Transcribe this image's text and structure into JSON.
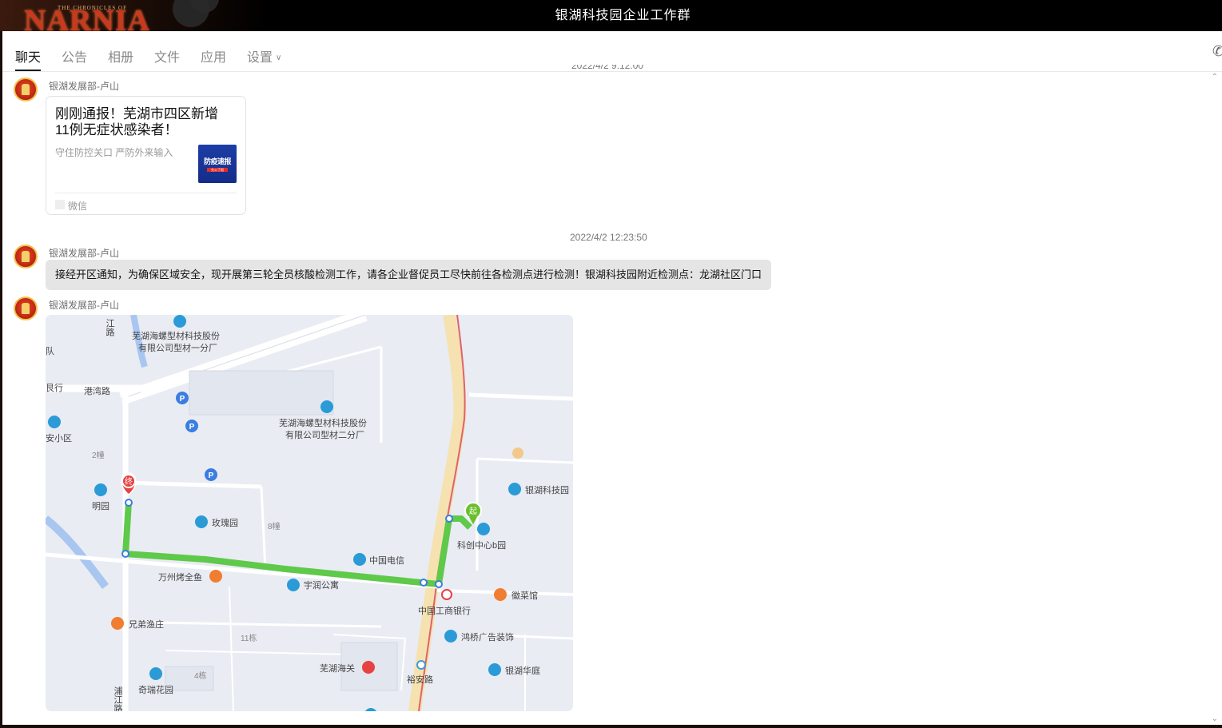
{
  "window": {
    "title": "银湖科技园企业工作群",
    "logo_top": "THE CHRONICLES OF",
    "logo_main": "NARNIA"
  },
  "tabs": [
    {
      "label": "聊天",
      "active": true
    },
    {
      "label": "公告"
    },
    {
      "label": "相册"
    },
    {
      "label": "文件"
    },
    {
      "label": "应用"
    },
    {
      "label": "设置"
    }
  ],
  "messages": [
    {
      "sender": "银湖发展部-卢山",
      "type": "article-card",
      "title": "刚刚通报！芜湖市四区新增11例无症状感染者！",
      "desc": "守住防控关口  严防外来输入",
      "thumb_text": "防疫速报",
      "thumb_sub": "先公了报",
      "source": "微信"
    },
    {
      "timestamp": "2022/4/2 12:23:50",
      "sender": "银湖发展部-卢山",
      "type": "text",
      "text": "接经开区通知，为确保区域安全，现开展第三轮全员核酸检测工作，请各企业督促员工尽快前往各检测点进行检测！银湖科技园附近检测点：龙湖社区门口"
    },
    {
      "sender": "银湖发展部-卢山",
      "type": "map-image",
      "labels": {
        "company1_l1": "芜湖海螺型材科技股份",
        "company1_l2": "有限公司型材一分厂",
        "company2_l1": "芜湖海螺型材科技股份",
        "company2_l2": "有限公司型材二分厂",
        "gangwan": "港湾路",
        "dui": "队",
        "yinhang": "艮行",
        "anxiaoqu": "安小区",
        "b2": "2幢",
        "mingyuan": "明园",
        "meiguiyuan": "玫瑰园",
        "b8": "8幢",
        "chinatelecom": "中国电信",
        "wanzhou": "万州烤全鱼",
        "yurun": "宇润公寓",
        "icbc": "中国工商银行",
        "xiongdi": "兄弟渔庄",
        "b11": "11栋",
        "customs": "芜湖海关",
        "b4": "4栋",
        "qirui": "奇瑞花园",
        "yuanroad": "裕安路",
        "yinhupark": "银湖科技园",
        "kechuang": "科创中心b园",
        "huicai": "徽菜馆",
        "hongqiao": "鸿桥广告装饰",
        "yinhuhuating": "银湖华庭",
        "pujiang": "浦江路",
        "jiang": "江路",
        "start": "起",
        "end": "终",
        "parking": "P"
      }
    }
  ]
}
